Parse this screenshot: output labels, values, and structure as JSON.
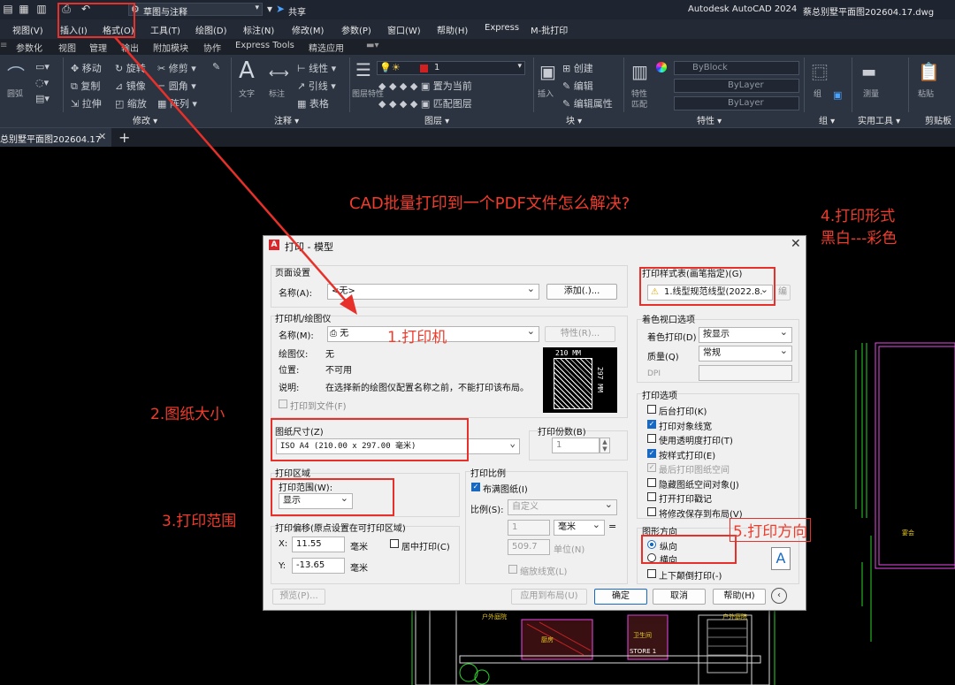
{
  "app": {
    "title": "Autodesk AutoCAD 2024",
    "file": "蔡总别墅平面图202604.17.dwg",
    "workspace": "草图与注释",
    "share": "共享"
  },
  "menu": [
    "视图(V)",
    "插入(I)",
    "格式(O)",
    "工具(T)",
    "绘图(D)",
    "标注(N)",
    "修改(M)",
    "参数(P)",
    "窗口(W)",
    "帮助(H)",
    "Express",
    "M-批打印"
  ],
  "ribbon_tabs": [
    "参数化",
    "视图",
    "管理",
    "输出",
    "附加模块",
    "协作",
    "Express Tools",
    "精选应用"
  ],
  "ribbon_groups": [
    "修改",
    "注释",
    "图层",
    "块",
    "特性",
    "组",
    "实用工具",
    "剪贴板"
  ],
  "ribbon_items": {
    "move": "移动",
    "rotate": "旋转",
    "trim": "修剪",
    "copy": "复制",
    "mirror": "镜像",
    "fillet": "圆角",
    "stretch": "拉伸",
    "scale": "缩放",
    "array": "阵列",
    "text": "文字",
    "dim": "标注",
    "linear": "线性",
    "leader": "引线",
    "table": "表格",
    "layer_props": "图层特性",
    "set_current": "置为当前",
    "match_layer": "匹配图层",
    "insert": "插入",
    "create": "创建",
    "edit": "编辑",
    "edit_attr": "编辑属性",
    "props": "特性",
    "match": "匹配",
    "group": "组",
    "measure": "测量",
    "paste": "粘贴",
    "byblock": "ByBlock",
    "bylayer1": "ByLayer",
    "bylayer2": "ByLayer",
    "layer_value": "1",
    "draw_order": "圆弧"
  },
  "doc_tab": "总别墅平面图202604.17",
  "dialog": {
    "title": "打印 - 模型",
    "page_setup": {
      "label": "页面设置",
      "name_label": "名称(A):",
      "name_value": "<无>",
      "add_btn": "添加(.)..."
    },
    "printer": {
      "label": "打印机/绘图仪",
      "name_label": "名称(M):",
      "name_value": "无",
      "props_btn": "特性(R)...",
      "plotter_label": "绘图仪:",
      "plotter_value": "无",
      "where_label": "位置:",
      "where_value": "不可用",
      "desc_label": "说明:",
      "desc_value": "在选择新的绘图仪配置名称之前，不能打印该布局。",
      "to_file": "打印到文件(F)",
      "dim_w": "210 MM",
      "dim_h": "297 MM"
    },
    "paper": {
      "label": "图纸尺寸(Z)",
      "value": "ISO A4 (210.00 x 297.00 毫米)"
    },
    "copies": {
      "label": "打印份数(B)",
      "value": "1"
    },
    "area": {
      "label": "打印区域",
      "what_label": "打印范围(W):",
      "what_value": "显示"
    },
    "offset": {
      "label": "打印偏移(原点设置在可打印区域)",
      "x_label": "X:",
      "x_value": "11.55",
      "y_label": "Y:",
      "y_value": "-13.65",
      "unit": "毫米",
      "center": "居中打印(C)"
    },
    "scale": {
      "label": "打印比例",
      "fit": "布满图纸(I)",
      "scale_label": "比例(S):",
      "scale_value": "自定义",
      "v1": "1",
      "unit": "毫米",
      "v2": "509.7",
      "unit2": "单位(N)",
      "lineweights": "缩放线宽(L)"
    },
    "style": {
      "label": "打印样式表(画笔指定)(G)",
      "value": "1.线型规范线型(2022.8.",
      "edit": "编"
    },
    "shaded": {
      "label": "着色视口选项",
      "shade_label": "着色打印(D)",
      "shade_value": "按显示",
      "quality_label": "质量(Q)",
      "quality_value": "常规",
      "dpi_label": "DPI"
    },
    "options": {
      "label": "打印选项",
      "items": [
        {
          "text": "后台打印(K)",
          "state": "off"
        },
        {
          "text": "打印对象线宽",
          "state": "on"
        },
        {
          "text": "使用透明度打印(T)",
          "state": "off"
        },
        {
          "text": "按样式打印(E)",
          "state": "on"
        },
        {
          "text": "最后打印图纸空间",
          "state": "dim"
        },
        {
          "text": "隐藏图纸空间对象(J)",
          "state": "off"
        },
        {
          "text": "打开打印戳记",
          "state": "off"
        },
        {
          "text": "将修改保存到布局(V)",
          "state": "off"
        }
      ]
    },
    "orientation": {
      "label": "图形方向",
      "portrait": "纵向",
      "landscape": "横向",
      "upside": "上下颠倒打印(-)"
    },
    "buttons": {
      "preview": "预览(P)...",
      "apply": "应用到布局(U)",
      "ok": "确定",
      "cancel": "取消",
      "help": "帮助(H)"
    }
  },
  "annotations": {
    "title": "CAD批量打印到一个PDF文件怎么解决?",
    "a1": "1.打印机",
    "a2": "2.图纸大小",
    "a3": "3.打印范围",
    "a4a": "4.打印形式",
    "a4b": "黑白---彩色",
    "a5": "5.打印方向"
  },
  "drawing": {
    "t1": "户外庭院",
    "t2": "户外庭院",
    "t3": "STORE 1",
    "t4": "卫生间",
    "t5": "厨房",
    "t6": "宴会"
  }
}
